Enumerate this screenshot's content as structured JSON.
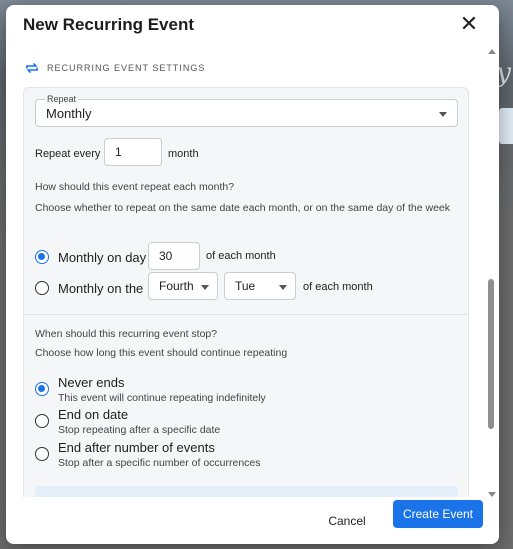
{
  "modal": {
    "title": "New Recurring Event",
    "close_icon": "close-icon"
  },
  "section": {
    "icon": "repeat-icon",
    "heading": "RECURRING EVENT SETTINGS"
  },
  "repeat": {
    "label": "Repeat",
    "value": "Monthly"
  },
  "repeat_every": {
    "label": "Repeat every",
    "value": "1",
    "unit": "month"
  },
  "monthly_mode": {
    "question": "How should this event repeat each month?",
    "help": "Choose whether to repeat on the same date each month, or on the same day of the week",
    "option_day": {
      "label": "Monthly on day",
      "value": "30",
      "suffix": "of each month",
      "selected": true
    },
    "option_the": {
      "label": "Monthly on the",
      "ordinal": "Fourth",
      "weekday": "Tue",
      "suffix": "of each month",
      "selected": false
    }
  },
  "end": {
    "question": "When should this recurring event stop?",
    "help": "Choose how long this event should continue repeating",
    "options": [
      {
        "label": "Never ends",
        "sub": "This event will continue repeating indefinitely",
        "selected": true
      },
      {
        "label": "End on date",
        "sub": "Stop repeating after a specific date",
        "selected": false
      },
      {
        "label": "End after number of events",
        "sub": "Stop after a specific number of occurrences",
        "selected": false
      }
    ]
  },
  "footer": {
    "cancel_label": "Cancel",
    "create_label": "Create Event"
  },
  "colors": {
    "accent": "#1a73e8"
  }
}
